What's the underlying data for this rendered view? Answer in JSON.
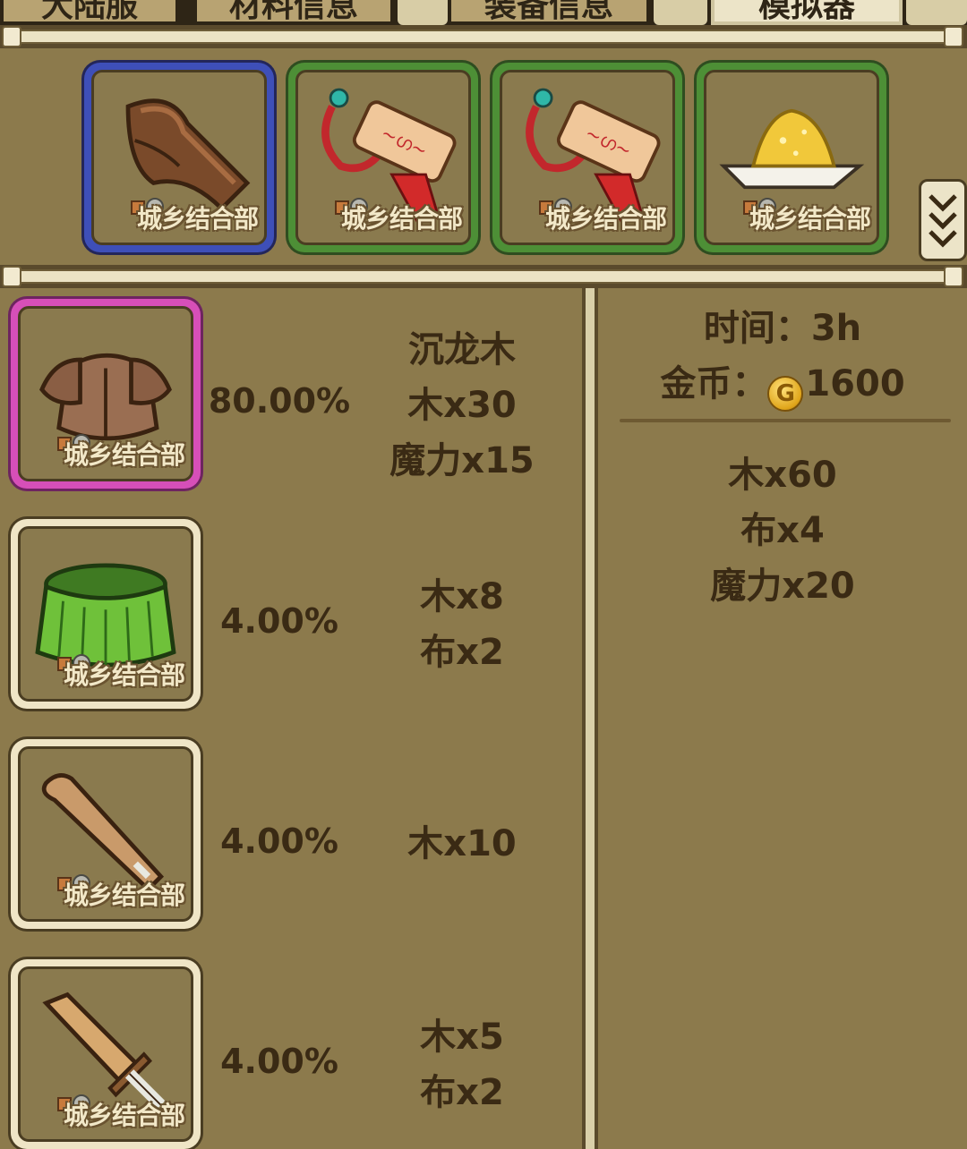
{
  "tabs": [
    {
      "label": "大陆服",
      "active": false
    },
    {
      "label": "材料信息",
      "active": false
    },
    {
      "label": "装备信息",
      "active": false
    },
    {
      "label": "模拟器",
      "active": true
    }
  ],
  "materials_bar": {
    "items": [
      {
        "name": "wood-plank",
        "rarity": "blue",
        "tag": "城乡结合部"
      },
      {
        "name": "magic-talisman",
        "rarity": "green",
        "tag": "城乡结合部"
      },
      {
        "name": "magic-talisman",
        "rarity": "green",
        "tag": "城乡结合部"
      },
      {
        "name": "gold-powder",
        "rarity": "green",
        "tag": "城乡结合部"
      }
    ],
    "more_icon": "double-chevron-down-icon"
  },
  "results": [
    {
      "icon": "wooden-armor",
      "rarity": "pink",
      "tag": "城乡结合部",
      "chance": "80.00%",
      "materials": [
        "沉龙木",
        "木x30",
        "魔力x15"
      ]
    },
    {
      "icon": "grass-skirt",
      "rarity": "plain",
      "tag": "城乡结合部",
      "chance": "4.00%",
      "materials": [
        "木x8",
        "布x2"
      ]
    },
    {
      "icon": "wooden-club",
      "rarity": "plain",
      "tag": "城乡结合部",
      "chance": "4.00%",
      "materials": [
        "木x10"
      ]
    },
    {
      "icon": "wooden-sword",
      "rarity": "plain",
      "tag": "城乡结合部",
      "chance": "4.00%",
      "materials": [
        "木x5",
        "布x2"
      ]
    }
  ],
  "cost": {
    "time_label": "时间：",
    "time_value": "3h",
    "gold_label": "金币：",
    "coin_glyph": "G",
    "gold_value": "1600"
  },
  "requirements": [
    "木x60",
    "布x4",
    "魔力x20"
  ],
  "colors": {
    "background": "#8c7a4c",
    "rarity_blue": "#3e4fb8",
    "rarity_green": "#4d8f36",
    "rarity_pink": "#d64fb8",
    "text": "#3a2a14"
  }
}
